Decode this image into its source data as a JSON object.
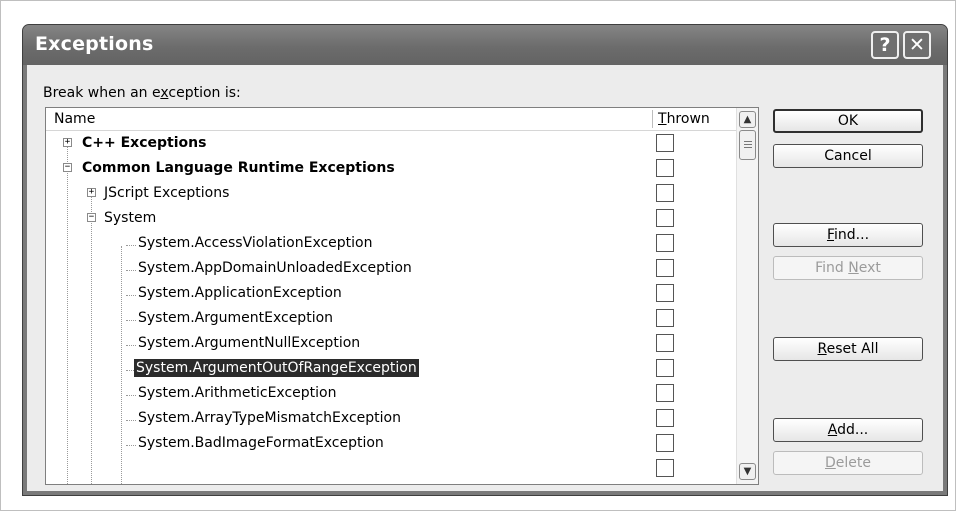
{
  "dialog": {
    "title": "Exceptions",
    "help_label": "?",
    "close_label": "✕"
  },
  "prompt": {
    "before": "Break when an e",
    "accel": "x",
    "after": "ception is:"
  },
  "list": {
    "columns": {
      "name": "Name",
      "thrown_accel": "T",
      "thrown_rest": "hrown"
    },
    "rows": [
      {
        "label": "C++ Exceptions",
        "bold": true,
        "expander": "+",
        "thrown": false
      },
      {
        "label": "Common Language Runtime Exceptions",
        "bold": true,
        "expander": "−",
        "thrown": false
      },
      {
        "label": "JScript Exceptions",
        "bold": false,
        "expander": "+",
        "thrown": false
      },
      {
        "label": "System",
        "bold": false,
        "expander": "−",
        "thrown": false
      },
      {
        "label": "System.AccessViolationException",
        "bold": false,
        "expander": "",
        "thrown": false
      },
      {
        "label": "System.AppDomainUnloadedException",
        "bold": false,
        "expander": "",
        "thrown": false
      },
      {
        "label": "System.ApplicationException",
        "bold": false,
        "expander": "",
        "thrown": false
      },
      {
        "label": "System.ArgumentException",
        "bold": false,
        "expander": "",
        "thrown": false
      },
      {
        "label": "System.ArgumentNullException",
        "bold": false,
        "expander": "",
        "thrown": false
      },
      {
        "label": "System.ArgumentOutOfRangeException",
        "bold": false,
        "expander": "",
        "thrown": false,
        "selected": true
      },
      {
        "label": "System.ArithmeticException",
        "bold": false,
        "expander": "",
        "thrown": false
      },
      {
        "label": "System.ArrayTypeMismatchException",
        "bold": false,
        "expander": "",
        "thrown": false
      },
      {
        "label": "System.BadImageFormatException",
        "bold": false,
        "expander": "",
        "thrown": false
      }
    ]
  },
  "buttons": {
    "ok": "OK",
    "cancel": "Cancel",
    "find_accel": "F",
    "find_rest": "ind...",
    "find_next_before": "Find ",
    "find_next_accel": "N",
    "find_next_after": "ext",
    "reset_accel": "R",
    "reset_rest": "eset All",
    "add_accel": "A",
    "add_rest": "dd...",
    "delete_accel": "D",
    "delete_rest": "elete"
  },
  "icons": {
    "scroll_up": "▲",
    "scroll_down": "▼"
  }
}
